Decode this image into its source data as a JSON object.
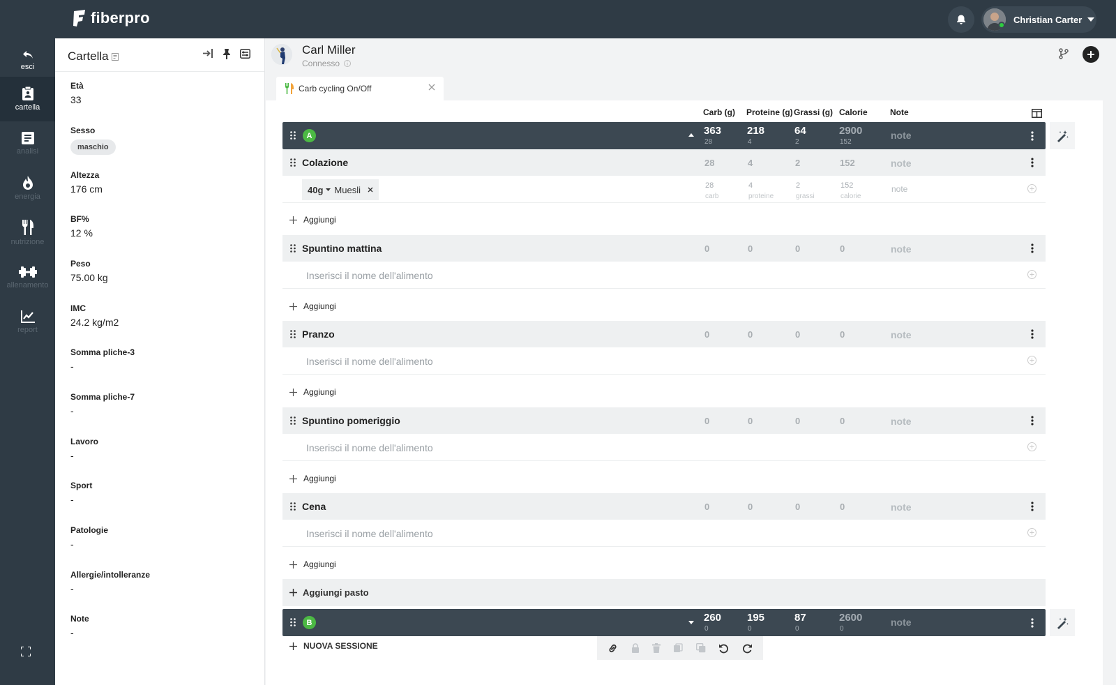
{
  "app": {
    "brand": "fiberpro"
  },
  "header": {
    "user_name": "Christian Carter"
  },
  "sidebar": {
    "items": [
      {
        "label": "esci",
        "icon": "undo-arrow-icon"
      },
      {
        "label": "cartella",
        "icon": "clipboard-icon"
      },
      {
        "label": "analisi",
        "icon": "document-icon"
      },
      {
        "label": "energia",
        "icon": "flame-icon"
      },
      {
        "label": "nutrizione",
        "icon": "fork-knife-icon"
      },
      {
        "label": "allenamento",
        "icon": "dumbbell-icon"
      },
      {
        "label": "report",
        "icon": "chart-line-icon"
      }
    ],
    "active": "cartella"
  },
  "panel": {
    "title": "Cartella",
    "fields": [
      {
        "label": "Età",
        "value": "33"
      },
      {
        "label": "Sesso",
        "value": "maschio"
      },
      {
        "label": "Altezza",
        "value": "176 cm"
      },
      {
        "label": "BF%",
        "value": "12 %"
      },
      {
        "label": "Peso",
        "value": "75.00 kg"
      },
      {
        "label": "IMC",
        "value": "24.2 kg/m2"
      },
      {
        "label": "Somma pliche-3",
        "value": "-"
      },
      {
        "label": "Somma pliche-7",
        "value": "-"
      },
      {
        "label": "Lavoro",
        "value": "-"
      },
      {
        "label": "Sport",
        "value": "-"
      },
      {
        "label": "Patologie",
        "value": "-"
      },
      {
        "label": "Allergie/intolleranze",
        "value": "-"
      },
      {
        "label": "Note",
        "value": "-"
      }
    ]
  },
  "patient": {
    "name": "Carl Miller",
    "status": "Connesso"
  },
  "tab": {
    "label": "Carb cycling On/Off"
  },
  "columns": {
    "carb": "Carb (g)",
    "protein": "Proteine (g)",
    "fat": "Grassi (g)",
    "calories": "Calorie",
    "note": "Note"
  },
  "sessions": [
    {
      "badge": "A",
      "carb": "363",
      "carb_sub": "28",
      "protein": "218",
      "protein_sub": "4",
      "fat": "64",
      "fat_sub": "2",
      "cal": "2900",
      "cal_sub": "152",
      "note": "note"
    },
    {
      "badge": "B",
      "carb": "260",
      "carb_sub": "0",
      "protein": "195",
      "protein_sub": "0",
      "fat": "87",
      "fat_sub": "0",
      "cal": "2600",
      "cal_sub": "0",
      "note": "note"
    }
  ],
  "meals": [
    {
      "name": "Colazione",
      "carb": "28",
      "protein": "4",
      "fat": "2",
      "cal": "152",
      "note": "note",
      "food": {
        "qty": "40g",
        "name": "Muesli",
        "carb": "28",
        "protein": "4",
        "fat": "2",
        "cal": "152",
        "carb_lbl": "carb",
        "protein_lbl": "proteine",
        "fat_lbl": "grassi",
        "cal_lbl": "calorie",
        "note": "note"
      }
    },
    {
      "name": "Spuntino mattina",
      "carb": "0",
      "protein": "0",
      "fat": "0",
      "cal": "0",
      "note": "note"
    },
    {
      "name": "Pranzo",
      "carb": "0",
      "protein": "0",
      "fat": "0",
      "cal": "0",
      "note": "note"
    },
    {
      "name": "Spuntino pomeriggio",
      "carb": "0",
      "protein": "0",
      "fat": "0",
      "cal": "0",
      "note": "note"
    },
    {
      "name": "Cena",
      "carb": "0",
      "protein": "0",
      "fat": "0",
      "cal": "0",
      "note": "note"
    }
  ],
  "food_placeholder": "Inserisci il nome dell'alimento",
  "labels": {
    "add": "Aggiungi",
    "add_meal": "Aggiungi pasto",
    "new_session": "NUOVA SESSIONE"
  }
}
